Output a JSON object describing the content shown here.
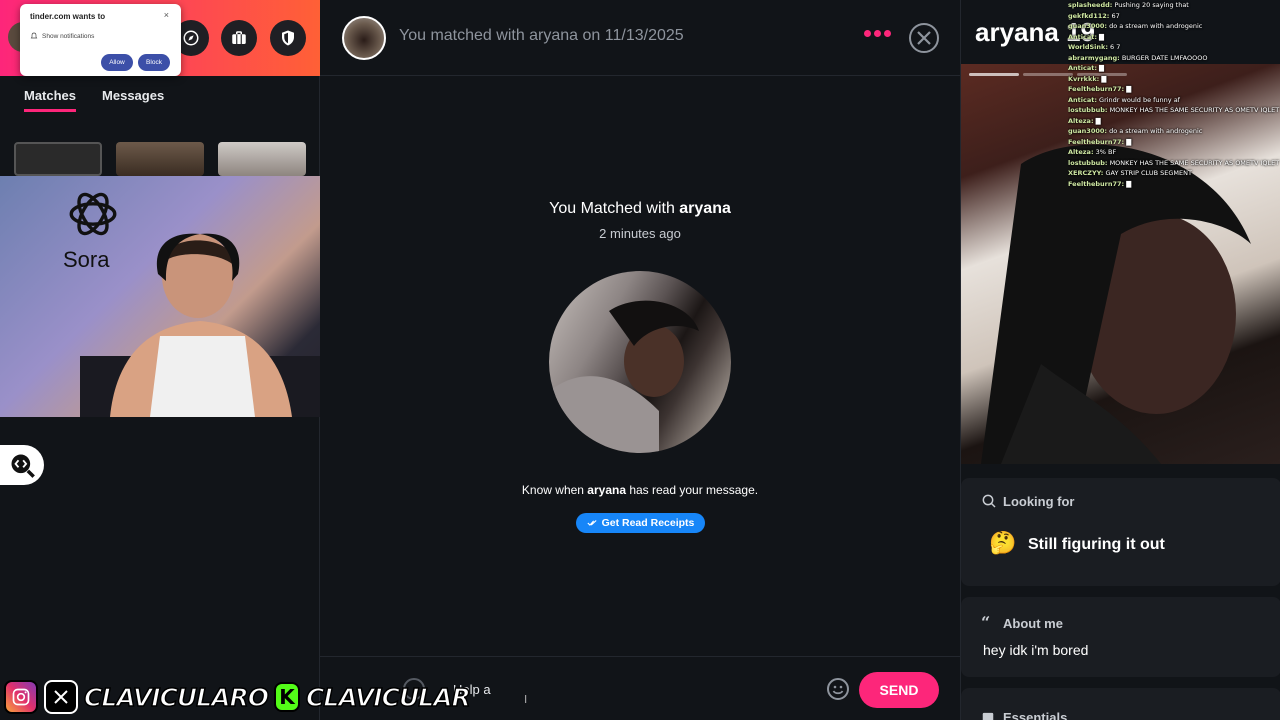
{
  "browser_notification": {
    "title": "tinder.com wants to",
    "line": "Show notifications",
    "allow": "Allow",
    "block": "Block",
    "close": "×"
  },
  "left": {
    "tabs": [
      {
        "label": "Matches",
        "active": true
      },
      {
        "label": "Messages",
        "active": false
      }
    ],
    "overlay_logo": "Sora",
    "socials": [
      "CLAVICULARO",
      "CLAVICULAR"
    ]
  },
  "conversation": {
    "header_title": "You matched with aryana on 11/13/2025",
    "matched_prefix": "You Matched with ",
    "matched_name": "aryana",
    "matched_time": "2 minutes ago",
    "receipts_prefix": "Know when ",
    "receipts_name": "aryana",
    "receipts_suffix": " has read your message.",
    "receipts_button": "Get Read Receipts",
    "input_value": "Help a ",
    "send_label": "SEND",
    "brand_color": "#fd267a",
    "receipts_color": "#1786f8"
  },
  "profile": {
    "name_age": "aryana 19",
    "looking_for_title": "Looking for",
    "looking_for_value": "Still figuring it out",
    "looking_for_emoji": "🤔",
    "about_title": "About me",
    "about_text": "hey idk i'm bored",
    "essentials_title": "Essentials"
  },
  "stream_chat": [
    {
      "user": "splasheedd:",
      "msg": "Pushing 20 saying that"
    },
    {
      "user": "gekfkd112:",
      "msg": "67"
    },
    {
      "user": "guan3000:",
      "msg": "do a stream with androgenic"
    },
    {
      "user": "Anticat:",
      "msg": "▇"
    },
    {
      "user": "WorldSink:",
      "msg": "6 7"
    },
    {
      "user": "abrarmygang:",
      "msg": "BURGER DATE LMFAOOOO"
    },
    {
      "user": "Anticat:",
      "msg": "▇"
    },
    {
      "user": "Kvrrkkk:",
      "msg": "▇"
    },
    {
      "user": "Feeltheburn77:",
      "msg": "▇"
    },
    {
      "user": "Anticat:",
      "msg": "Grindr would be funny af"
    },
    {
      "user": "lostubbub:",
      "msg": "MONKEY HAS THE SAME SECURITY AS OMETV IQLET"
    },
    {
      "user": "Alteza:",
      "msg": "▇"
    },
    {
      "user": "guan3000:",
      "msg": "do a stream with androgenic"
    },
    {
      "user": "Feeltheburn77:",
      "msg": "▇"
    },
    {
      "user": "Alteza:",
      "msg": "3% BF"
    },
    {
      "user": "lostubbub:",
      "msg": "MONKEY HAS THE SAME SECURITY AS OMETV IQLET"
    },
    {
      "user": "XERCZYY:",
      "msg": "GAY STRIP CLUB SEGMENT"
    },
    {
      "user": "Feeltheburn77:",
      "msg": "▇"
    }
  ]
}
